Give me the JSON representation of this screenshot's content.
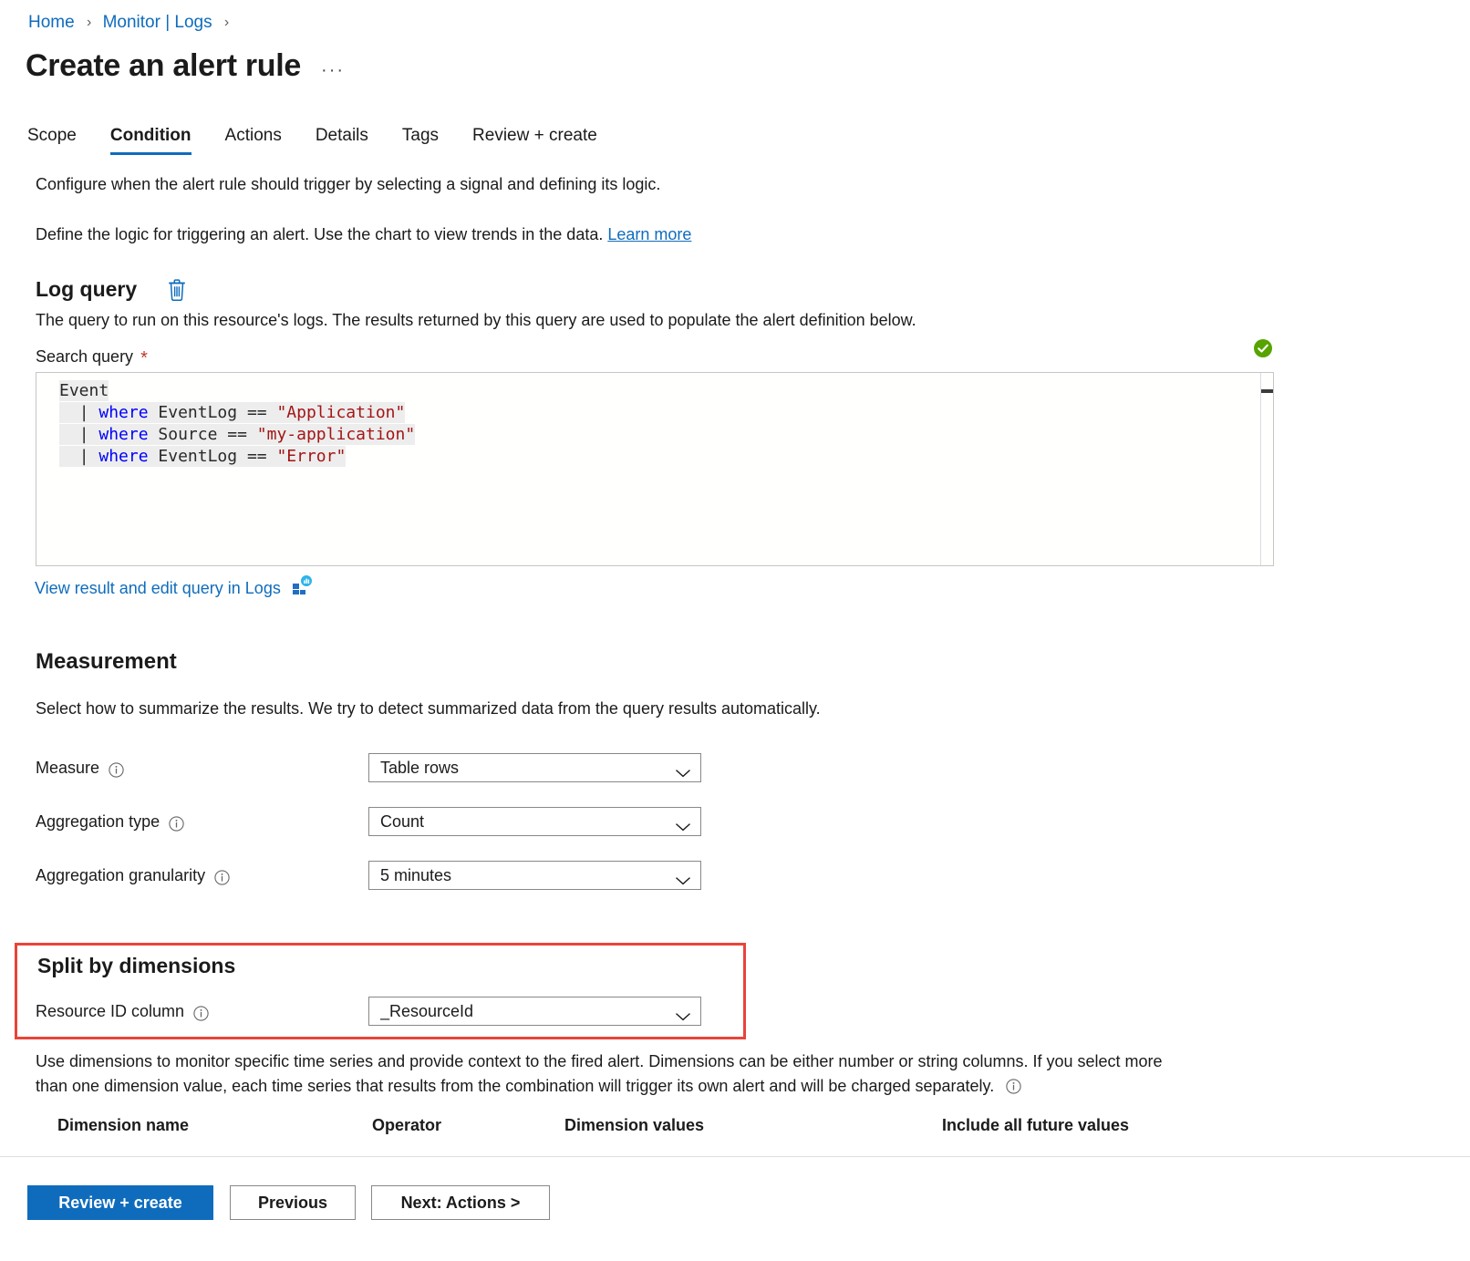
{
  "breadcrumb": {
    "items": [
      {
        "label": "Home"
      },
      {
        "label": "Monitor | Logs"
      }
    ],
    "separator": "›"
  },
  "header": {
    "title": "Create an alert rule",
    "more_label": "···"
  },
  "tabs": [
    {
      "label": "Scope",
      "active": false
    },
    {
      "label": "Condition",
      "active": true
    },
    {
      "label": "Actions",
      "active": false
    },
    {
      "label": "Details",
      "active": false
    },
    {
      "label": "Tags",
      "active": false
    },
    {
      "label": "Review + create",
      "active": false
    }
  ],
  "intro": {
    "line1": "Configure when the alert rule should trigger by selecting a signal and defining its logic.",
    "line2_prefix": "Define the logic for triggering an alert. Use the chart to view trends in the data. ",
    "line2_link": "Learn more"
  },
  "log_query": {
    "heading": "Log query",
    "delete_icon": "trash-icon",
    "description": "The query to run on this resource's logs. The results returned by this query are used to populate the alert definition below.",
    "field_label": "Search query",
    "required_marker": "*",
    "validation_icon": "green-check-icon",
    "editor": {
      "lines": [
        {
          "indent": 0,
          "highlight": true,
          "tokens": [
            {
              "t": "Event",
              "c": "id"
            }
          ]
        },
        {
          "indent": 1,
          "highlight": true,
          "tokens": [
            {
              "t": "| ",
              "c": "pipe"
            },
            {
              "t": "where",
              "c": "kw"
            },
            {
              "t": " EventLog ",
              "c": "id"
            },
            {
              "t": "== ",
              "c": "op"
            },
            {
              "t": "\"Application\"",
              "c": "str"
            }
          ]
        },
        {
          "indent": 1,
          "highlight": true,
          "tokens": [
            {
              "t": "| ",
              "c": "pipe"
            },
            {
              "t": "where",
              "c": "kw"
            },
            {
              "t": " Source ",
              "c": "id"
            },
            {
              "t": "== ",
              "c": "op"
            },
            {
              "t": "\"my-application\"",
              "c": "str"
            }
          ]
        },
        {
          "indent": 1,
          "highlight": true,
          "tokens": [
            {
              "t": "| ",
              "c": "pipe"
            },
            {
              "t": "where",
              "c": "kw"
            },
            {
              "t": " EventLog ",
              "c": "id"
            },
            {
              "t": "== ",
              "c": "op"
            },
            {
              "t": "\"Error\"",
              "c": "str"
            }
          ]
        }
      ]
    },
    "view_result_link": "View result and edit query in Logs",
    "view_result_icon": "logs-analytics-icon"
  },
  "measurement": {
    "heading": "Measurement",
    "description": "Select how to summarize the results. We try to detect summarized data from the query results automatically.",
    "fields": [
      {
        "label": "Measure",
        "value": "Table rows",
        "info": true
      },
      {
        "label": "Aggregation type",
        "value": "Count",
        "info": true
      },
      {
        "label": "Aggregation granularity",
        "value": "5 minutes",
        "info": true
      }
    ]
  },
  "split_by_dimensions": {
    "heading": "Split by dimensions",
    "resource_id": {
      "label": "Resource ID column",
      "value": "_ResourceId",
      "info": true
    },
    "highlight_color": "#e8443a",
    "description_line1": "Use dimensions to monitor specific time series and provide context to the fired alert. Dimensions can be either number or string columns. If you select more",
    "description_line2": "than one dimension value, each time series that results from the combination will trigger its own alert and will be charged separately.",
    "table_headers": [
      "Dimension name",
      "Operator",
      "Dimension values",
      "Include all future values"
    ]
  },
  "footer": {
    "review_create": "Review + create",
    "previous": "Previous",
    "next": "Next: Actions >"
  },
  "colors": {
    "accent": "#0f6cbd",
    "link": "#0f6cbd",
    "valid_green": "#57a300",
    "highlight_red": "#e8443a",
    "required_red": "#c0392b",
    "kql_keyword": "#0000ff",
    "kql_string": "#a31515"
  }
}
